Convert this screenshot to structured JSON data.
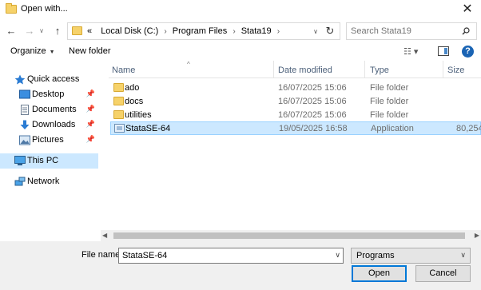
{
  "window": {
    "title": "Open with...",
    "close_glyph": "✕"
  },
  "nav": {
    "back_glyph": "←",
    "forward_glyph": "→",
    "history_glyph": "∨",
    "up_glyph": "↑",
    "breadcrumb": {
      "overflow": "«",
      "items": [
        "Local Disk (C:)",
        "Program Files",
        "Stata19"
      ],
      "separator": "›"
    },
    "dropdown_glyph": "∨",
    "refresh_glyph": "↻"
  },
  "search": {
    "placeholder": "Search Stata19"
  },
  "toolbar": {
    "organize_label": "Organize",
    "organize_caret": "▼",
    "new_folder_label": "New folder",
    "view_glyph": "☷ ▾",
    "help_glyph": "?"
  },
  "sidebar": {
    "items": [
      {
        "label": "Quick access",
        "icon": "star-icon",
        "pinned": false,
        "selected": false
      },
      {
        "label": "Desktop",
        "icon": "desktop-icon",
        "pinned": true,
        "selected": false
      },
      {
        "label": "Documents",
        "icon": "documents-icon",
        "pinned": true,
        "selected": false
      },
      {
        "label": "Downloads",
        "icon": "downloads-icon",
        "pinned": true,
        "selected": false
      },
      {
        "label": "Pictures",
        "icon": "pictures-icon",
        "pinned": true,
        "selected": false
      },
      {
        "label": "This PC",
        "icon": "computer-icon",
        "pinned": false,
        "selected": true
      },
      {
        "label": "Network",
        "icon": "network-icon",
        "pinned": false,
        "selected": false
      }
    ],
    "pin_glyph": "📌"
  },
  "columns": {
    "name": "Name",
    "date": "Date modified",
    "type": "Type",
    "size": "Size",
    "sort_glyph": "^"
  },
  "files": [
    {
      "name": "ado",
      "date": "16/07/2025 15:06",
      "type": "File folder",
      "size": "",
      "kind": "folder",
      "selected": false
    },
    {
      "name": "docs",
      "date": "16/07/2025 15:06",
      "type": "File folder",
      "size": "",
      "kind": "folder",
      "selected": false
    },
    {
      "name": "utilities",
      "date": "16/07/2025 15:06",
      "type": "File folder",
      "size": "",
      "kind": "folder",
      "selected": false
    },
    {
      "name": "StataSE-64",
      "date": "19/05/2025 16:58",
      "type": "Application",
      "size": "80,254",
      "kind": "app",
      "selected": true
    }
  ],
  "scroll": {
    "left_glyph": "◀",
    "right_glyph": "▶"
  },
  "footer": {
    "filename_label": "File name:",
    "filename_value": "StataSE-64",
    "dropdown_glyph": "∨",
    "filetype_value": "Programs",
    "open_label": "Open",
    "cancel_label": "Cancel"
  },
  "colors": {
    "accent": "#0078d7",
    "selection": "#cce8ff",
    "folder": "#f6d26a"
  }
}
